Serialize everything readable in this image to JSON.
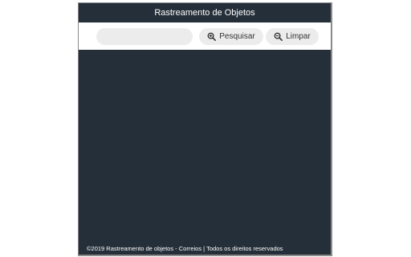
{
  "header": {
    "title": "Rastreamento de Objetos"
  },
  "search": {
    "value": "",
    "placeholder": ""
  },
  "buttons": {
    "search_label": "Pesquisar",
    "search_icon": "zoom-in-icon",
    "clear_label": "Limpar",
    "clear_icon": "zoom-out-icon"
  },
  "footer": {
    "text": "©2019 Rastreamento de objetos - Correios | Todos os direitos reservados"
  },
  "colors": {
    "background": "#252f39",
    "toolbar": "#ffffff",
    "button": "#ececec"
  }
}
